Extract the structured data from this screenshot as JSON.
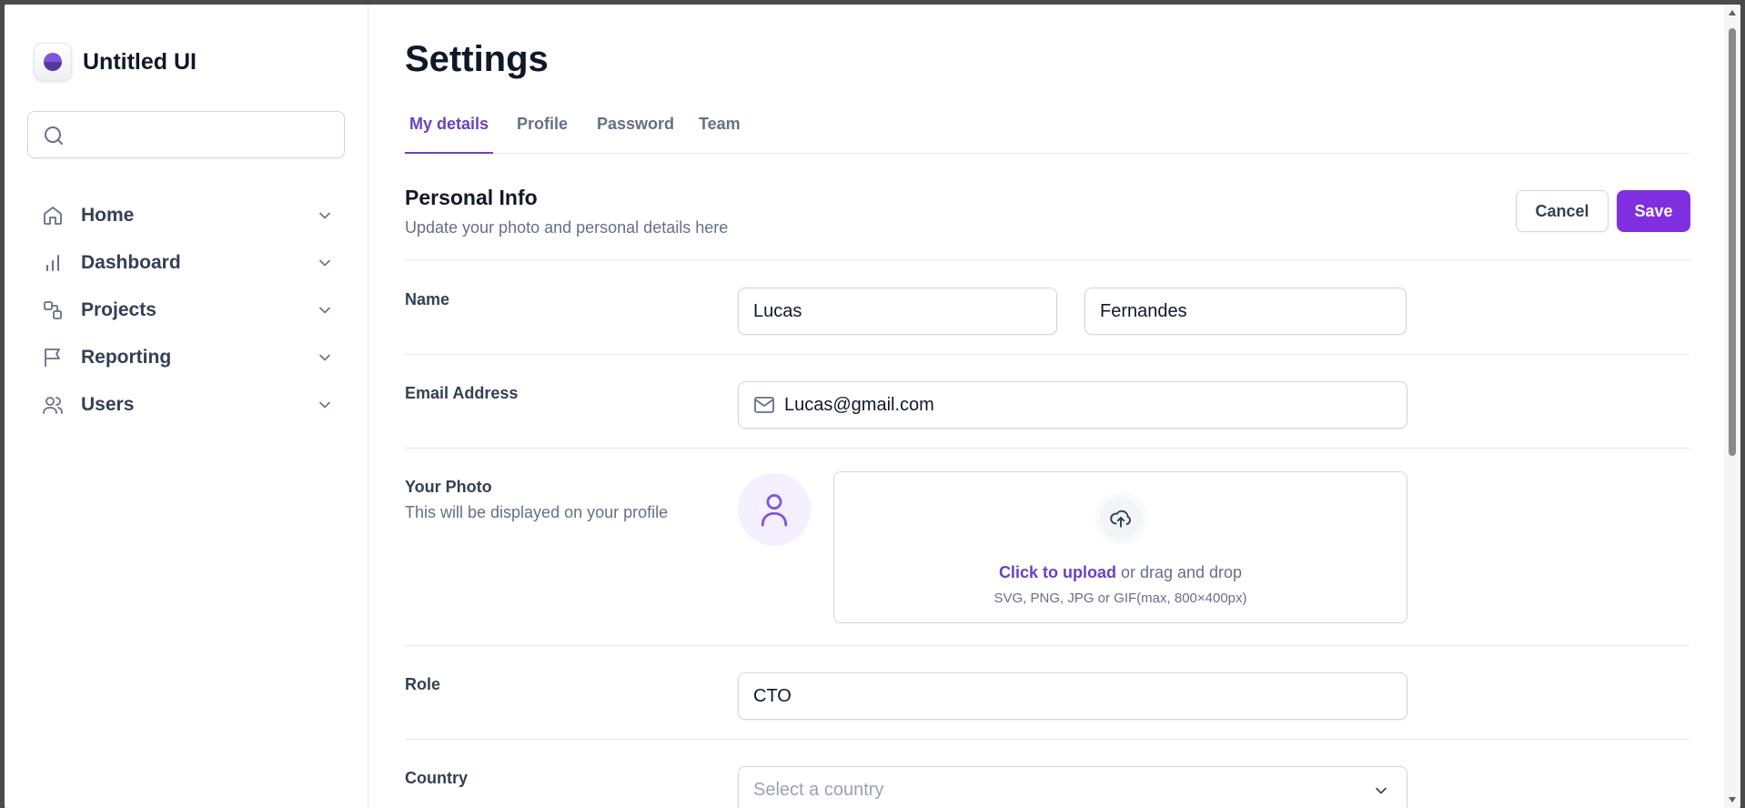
{
  "app": {
    "name": "Untitled UI"
  },
  "search": {
    "placeholder": "",
    "value": ""
  },
  "sidebar": {
    "items": [
      {
        "label": "Home",
        "icon": "home-icon"
      },
      {
        "label": "Dashboard",
        "icon": "bar-chart-icon"
      },
      {
        "label": "Projects",
        "icon": "layers-icon"
      },
      {
        "label": "Reporting",
        "icon": "flag-icon"
      },
      {
        "label": "Users",
        "icon": "users-icon"
      }
    ]
  },
  "page": {
    "title": "Settings"
  },
  "tabs": [
    {
      "label": "My details",
      "active": true
    },
    {
      "label": "Profile",
      "active": false
    },
    {
      "label": "Password",
      "active": false
    },
    {
      "label": "Team",
      "active": false
    }
  ],
  "section": {
    "title": "Personal Info",
    "subtitle": "Update your photo and personal details here",
    "cancel_label": "Cancel",
    "save_label": "Save"
  },
  "form": {
    "name": {
      "label": "Name",
      "first": "Lucas",
      "last": "Fernandes"
    },
    "email": {
      "label": "Email Address",
      "value": "Lucas@gmail.com"
    },
    "photo": {
      "label": "Your Photo",
      "hint": "This will be displayed on your profile",
      "upload_link": "Click to upload",
      "upload_text": " or drag and drop",
      "upload_formats": "SVG, PNG, JPG or GIF(max, 800×400px)"
    },
    "role": {
      "label": "Role",
      "value": "CTO"
    },
    "country": {
      "label": "Country",
      "placeholder": "Select a country"
    }
  },
  "colors": {
    "accent": "#7f2fe0",
    "tab_active": "#6941c6",
    "muted": "#667085"
  }
}
